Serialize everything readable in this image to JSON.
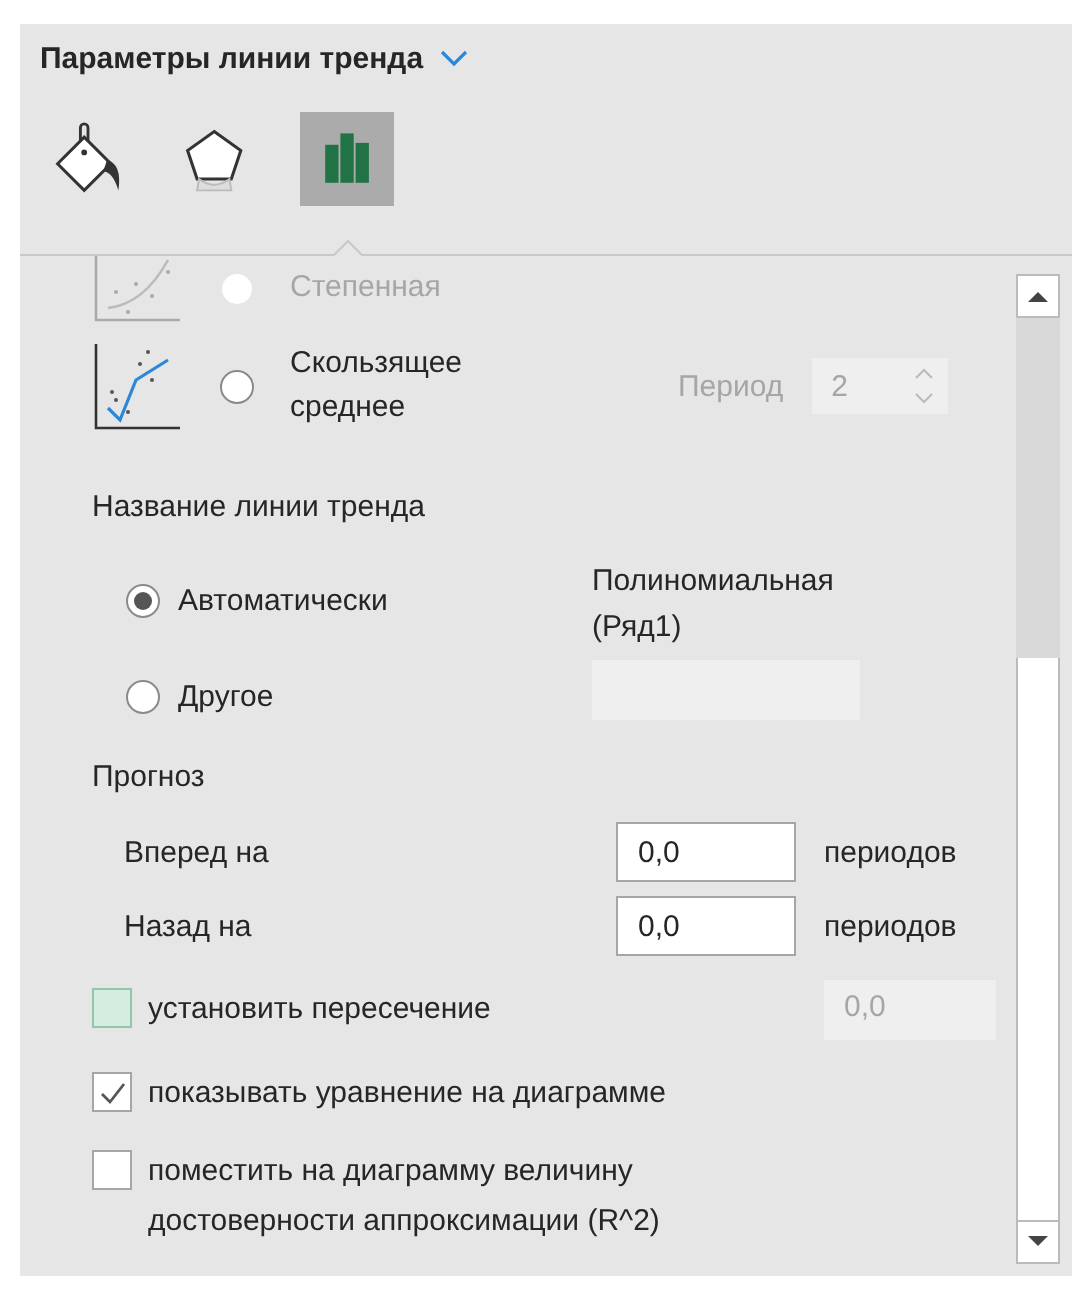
{
  "header": {
    "title": "Параметры линии тренда"
  },
  "tabs": [
    {
      "kind": "fill",
      "selected": false
    },
    {
      "kind": "effects",
      "selected": false
    },
    {
      "kind": "options",
      "selected": true
    }
  ],
  "trend_types": [
    {
      "kind": "power",
      "label": "Степенная",
      "selected": false
    },
    {
      "kind": "moving-average",
      "label": "Скользящее среднее",
      "selected": false,
      "period": {
        "label": "Период",
        "value": "2",
        "disabled": true
      }
    }
  ],
  "trend_name": {
    "title": "Название линии тренда",
    "options": [
      {
        "label": "Автоматически",
        "selected": true,
        "value": "Полиномиальная (Ряд1)"
      },
      {
        "label": "Другое",
        "selected": false,
        "field_disabled": true
      }
    ]
  },
  "forecast": {
    "title": "Прогноз",
    "rows": [
      {
        "label": "Вперед на",
        "value": "0,0",
        "unit": "периодов"
      },
      {
        "label": "Назад на",
        "value": "0,0",
        "unit": "периодов"
      }
    ]
  },
  "checks": [
    {
      "label": "установить пересечение",
      "checked": false,
      "focused": true,
      "field": {
        "value": "0,0",
        "disabled": true
      }
    },
    {
      "label": "показывать уравнение на диаграмме",
      "checked": true,
      "focused": false
    },
    {
      "label": "поместить на диаграмму величину достоверности аппроксимации (R^2)",
      "checked": false,
      "focused": false
    }
  ]
}
